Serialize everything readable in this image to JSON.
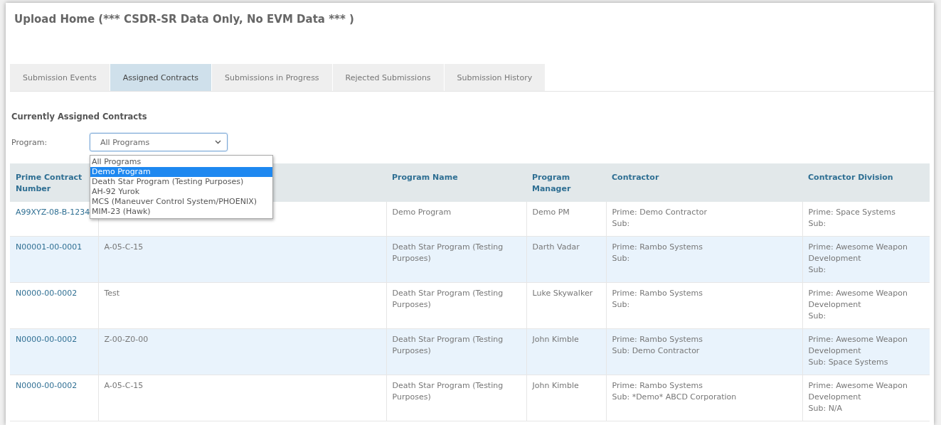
{
  "page": {
    "title": "Upload Home (*** CSDR-SR Data Only, No EVM Data *** )"
  },
  "tabs": [
    {
      "label": "Submission Events",
      "selected": false
    },
    {
      "label": "Assigned Contracts",
      "selected": true
    },
    {
      "label": "Submissions in Progress",
      "selected": false
    },
    {
      "label": "Rejected Submissions",
      "selected": false
    },
    {
      "label": "Submission History",
      "selected": false
    }
  ],
  "section_heading": "Currently Assigned Contracts",
  "program_filter": {
    "label": "Program:",
    "value": "All Programs",
    "expanded": true,
    "options": [
      {
        "label": "All Programs",
        "highlighted": false
      },
      {
        "label": "Demo Program",
        "highlighted": true
      },
      {
        "label": "Death Star Program (Testing Purposes)",
        "highlighted": false
      },
      {
        "label": "AH-92 Yurok",
        "highlighted": false
      },
      {
        "label": "MCS (Maneuver Control System/PHOENIX)",
        "highlighted": false
      },
      {
        "label": "MIM-23 (Hawk)",
        "highlighted": false
      }
    ]
  },
  "table": {
    "columns": [
      {
        "label": "Prime Contract Number"
      },
      {},
      {
        "label": "Program Name"
      },
      {
        "label": "Program Manager"
      },
      {
        "label": "Contractor"
      },
      {
        "label": "Contractor Division"
      }
    ],
    "rows": [
      {
        "contract_number": "A99XYZ-08-B-1234",
        "column_2": null,
        "program_name": "Demo Program",
        "program_manager": "Demo PM",
        "contractor": [
          "Prime: Demo Contractor",
          "Sub:"
        ],
        "contractor_division": [
          "Prime: Space Systems",
          "Sub:"
        ]
      },
      {
        "contract_number": "N00001-00-0001",
        "column_2": "A-05-C-15",
        "program_name": "Death Star Program (Testing Purposes)",
        "program_manager": "Darth Vadar",
        "contractor": [
          "Prime: Rambo Systems",
          "Sub:"
        ],
        "contractor_division": [
          "Prime: Awesome Weapon Development",
          "Sub:"
        ]
      },
      {
        "contract_number": "N0000-00-0002",
        "column_2": "Test",
        "program_name": "Death Star Program (Testing Purposes)",
        "program_manager": "Luke Skywalker",
        "contractor": [
          "Prime: Rambo Systems",
          "Sub:"
        ],
        "contractor_division": [
          "Prime: Awesome Weapon Development",
          "Sub:"
        ]
      },
      {
        "contract_number": "N0000-00-0002",
        "column_2": "Z-00-Z0-00",
        "program_name": "Death Star Program (Testing Purposes)",
        "program_manager": "John Kimble",
        "contractor": [
          "Prime: Rambo Systems",
          "Sub: Demo Contractor"
        ],
        "contractor_division": [
          "Prime: Awesome Weapon Development",
          "Sub: Space Systems"
        ]
      },
      {
        "contract_number": "N0000-00-0002",
        "column_2": "A-05-C-15",
        "program_name": "Death Star Program (Testing Purposes)",
        "program_manager": "John Kimble",
        "contractor": [
          "Prime: Rambo Systems",
          "Sub: *Demo* ABCD Corporation"
        ],
        "contractor_division": [
          "Prime: Awesome Weapon Development",
          "Sub: N/A"
        ]
      }
    ]
  }
}
